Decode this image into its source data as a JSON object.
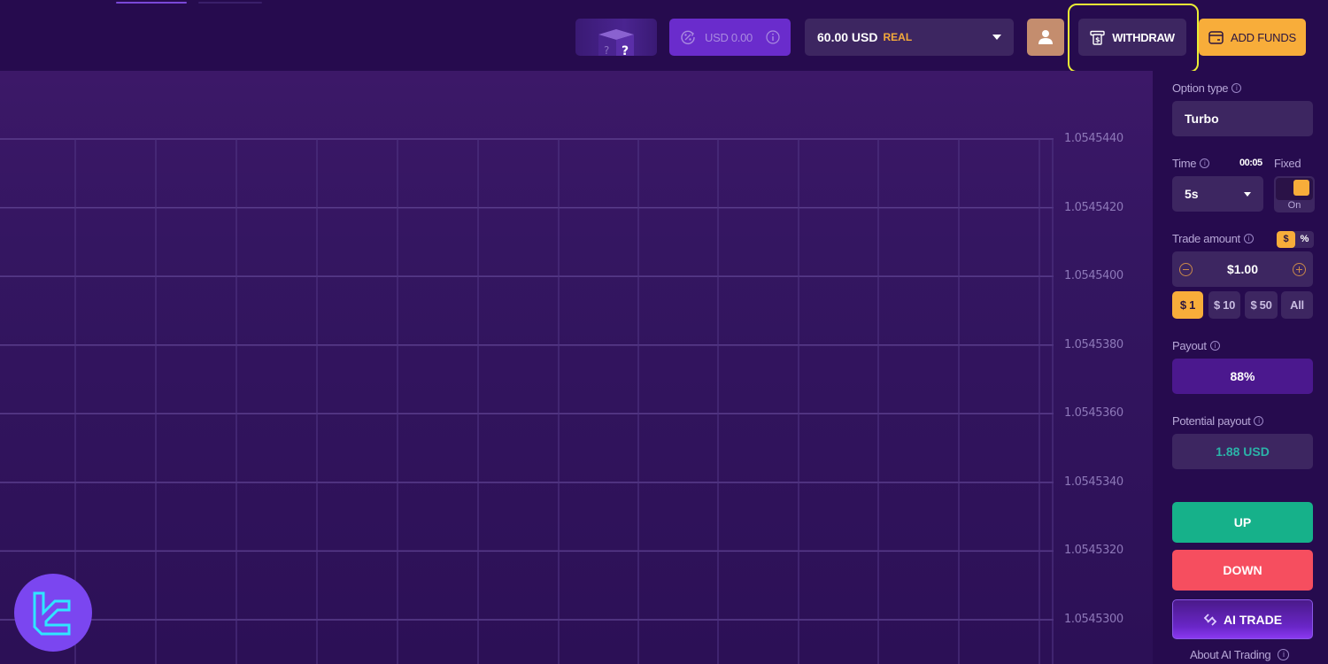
{
  "header": {
    "tabs": [
      {
        "state": "active"
      },
      {
        "state": "inactive"
      }
    ],
    "mystery_box": {
      "icon": "mystery-box-icon",
      "glyph": "?"
    },
    "bonus": {
      "value": "USD 0.00",
      "icon": "percent-cycle-icon",
      "info_icon": "info-icon"
    },
    "balance": {
      "amount": "60.00 USD",
      "account_type": "REAL",
      "caret_icon": "caret-down-icon"
    },
    "profile": {
      "icon": "user-icon"
    },
    "withdraw": {
      "label": "WITHDRAW",
      "icon": "withdraw-atm-icon",
      "highlighted": true,
      "highlight_color": "#e9ed35"
    },
    "add_funds": {
      "label": "ADD FUNDS",
      "icon": "wallet-card-icon",
      "color": "#f8ad3a"
    }
  },
  "chart": {
    "y_ticks": [
      "1.0545440",
      "1.0545420",
      "1.0545400",
      "1.0545380",
      "1.0545360",
      "1.0545340",
      "1.0545320",
      "1.0545300"
    ]
  },
  "chart_data": {
    "type": "line",
    "title": "",
    "xlabel": "",
    "ylabel": "",
    "y_tick_values": [
      1.054544,
      1.054542,
      1.05454,
      1.054538,
      1.054536,
      1.054534,
      1.054532,
      1.05453
    ],
    "ylim": [
      1.05453,
      1.054544
    ],
    "grid": true,
    "series": []
  },
  "sidebar": {
    "option_type": {
      "label": "Option type",
      "value": "Turbo"
    },
    "time": {
      "label": "Time",
      "countdown": "00:05",
      "value": "5s"
    },
    "fixed": {
      "label": "Fixed",
      "state": "On"
    },
    "trade_amount": {
      "label": "Trade amount",
      "value": "$1.00",
      "unit_options": [
        "$",
        "%"
      ],
      "selected_unit": "$"
    },
    "presets": [
      {
        "label": "$ 1",
        "active": true
      },
      {
        "label": "$ 10",
        "active": false
      },
      {
        "label": "$ 50",
        "active": false
      },
      {
        "label": "All",
        "active": false
      }
    ],
    "payout": {
      "label": "Payout",
      "value": "88%"
    },
    "potential_payout": {
      "label": "Potential payout",
      "value": "1.88 USD"
    },
    "up_label": "UP",
    "down_label": "DOWN",
    "ai_trade_label": "AI TRADE",
    "about_ai_label": "About AI Trading",
    "colors": {
      "up": "#16b18a",
      "down": "#f64e5f",
      "accent": "#f8ad3a",
      "potential": "#2bb3a8"
    }
  },
  "watermark": {
    "icon": "tc-logo-icon"
  }
}
